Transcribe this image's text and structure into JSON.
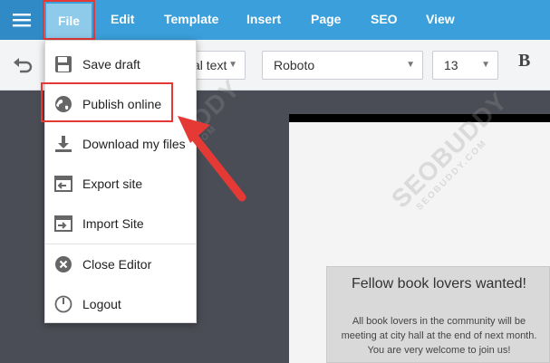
{
  "menubar": {
    "file_label": "File",
    "items": [
      "Edit",
      "Template",
      "Insert",
      "Page",
      "SEO",
      "View"
    ]
  },
  "toolbar": {
    "text_style_value": "al text",
    "font_value": "Roboto",
    "size_value": "13",
    "bold_label": "B"
  },
  "file_menu": {
    "items": [
      {
        "label": "Save draft",
        "icon": "save-icon"
      },
      {
        "label": "Publish online",
        "icon": "globe-icon"
      },
      {
        "label": "Download my files",
        "icon": "download-icon"
      },
      {
        "label": "Export site",
        "icon": "export-icon"
      },
      {
        "label": "Import Site",
        "icon": "import-icon"
      },
      {
        "label": "Close Editor",
        "icon": "close-circle-icon"
      },
      {
        "label": "Logout",
        "icon": "power-icon"
      }
    ]
  },
  "page_content": {
    "card_title": "Fellow book lovers wanted!",
    "card_line1": "All book lovers in the community will be",
    "card_line2": "meeting at city hall at the end of next month.",
    "card_line3": "You are very welcome to join us!"
  },
  "watermark": {
    "text": "SEOBUDDY",
    "small_text": "SEOBUDDY.COM"
  },
  "colors": {
    "menubar": "#3b9fdb",
    "highlight": "#e53935",
    "canvas": "#4a4d55"
  }
}
